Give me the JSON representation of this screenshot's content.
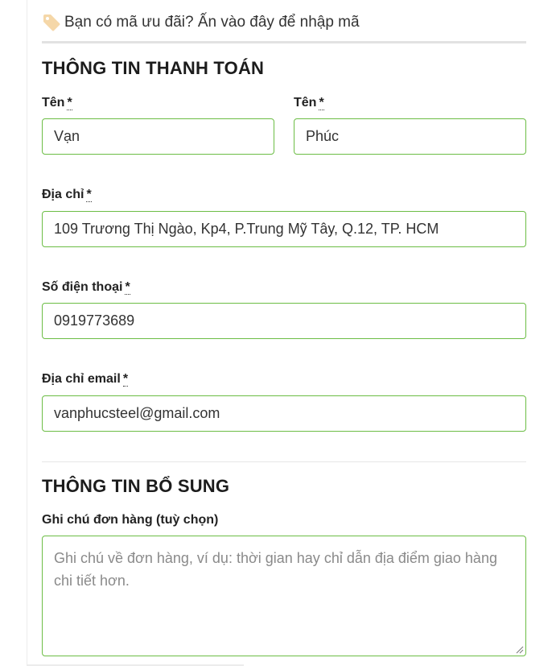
{
  "coupon": {
    "icon": "tag-icon",
    "text": "Bạn có mã ưu đãi? Ấn vào đây để nhập mã"
  },
  "billing": {
    "title": "THÔNG TIN THANH TOÁN",
    "first_name": {
      "label": "Tên",
      "required_mark": "*",
      "value": "Vạn"
    },
    "last_name": {
      "label": "Tên",
      "required_mark": "*",
      "value": "Phúc"
    },
    "address": {
      "label": "Địa chỉ",
      "required_mark": "*",
      "value": "109 Trương Thị Ngào, Kp4, P.Trung Mỹ Tây, Q.12, TP. HCM"
    },
    "phone": {
      "label": "Số điện thoại",
      "required_mark": "*",
      "value": "0919773689"
    },
    "email": {
      "label": "Địa chỉ email",
      "required_mark": "*",
      "value": "vanphucsteel@gmail.com"
    }
  },
  "additional": {
    "title": "THÔNG TIN BỔ SUNG",
    "notes": {
      "label": "Ghi chú đơn hàng (tuỳ chọn)",
      "placeholder": "Ghi chú về đơn hàng, ví dụ: thời gian hay chỉ dẫn địa điểm giao hàng chi tiết hơn."
    }
  },
  "colors": {
    "field_border": "#6cbd45",
    "tag_icon": "#f5d7a8"
  }
}
